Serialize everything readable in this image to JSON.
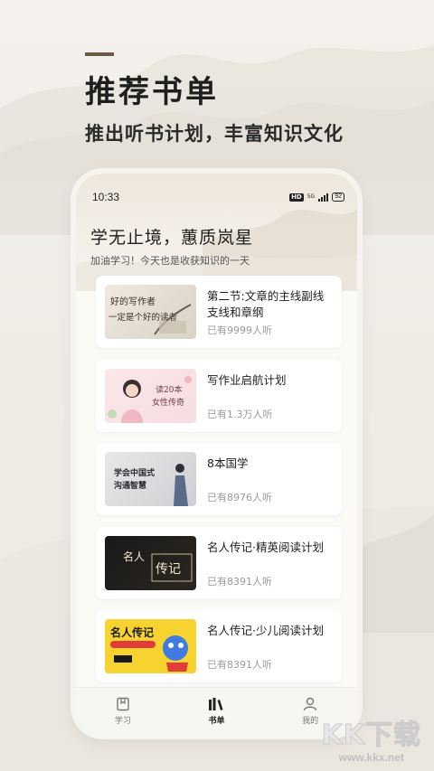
{
  "hero": {
    "title": "推荐书单",
    "subtitle": "推出听书计划，丰富知识文化"
  },
  "status_bar": {
    "time": "10:33",
    "hd": "HD",
    "network": "5G",
    "battery": "92"
  },
  "greeting": {
    "title": "学无止境，蕙质岚星",
    "subtitle": "加油学习！今天也是收获知识的一天"
  },
  "booklists": [
    {
      "title": "第二节:文章的主线副线支线和章纲",
      "listens": "已有9999人听",
      "cover_text": [
        "好的写作者",
        "一定是个好的读者"
      ]
    },
    {
      "title": "写作业启航计划",
      "listens": "已有1.3万人听",
      "cover_text": [
        "读20本",
        "女性传奇"
      ]
    },
    {
      "title": "8本国学",
      "listens": "已有8976人听",
      "cover_text": [
        "学会中国式",
        "沟通智慧"
      ]
    },
    {
      "title": "名人传记·精英阅读计划",
      "listens": "已有8391人听",
      "cover_text": [
        "名人",
        "传记"
      ]
    },
    {
      "title": "名人传记·少儿阅读计划",
      "listens": "已有8391人听",
      "cover_text": [
        "名人传记"
      ]
    }
  ],
  "tabbar": [
    {
      "label": "学习",
      "icon": "book-icon",
      "active": false
    },
    {
      "label": "书单",
      "icon": "bookshelf-icon",
      "active": true
    },
    {
      "label": "我的",
      "icon": "user-icon",
      "active": false
    }
  ],
  "watermark": {
    "logo": "KK下载",
    "url": "www.kkx.net"
  }
}
